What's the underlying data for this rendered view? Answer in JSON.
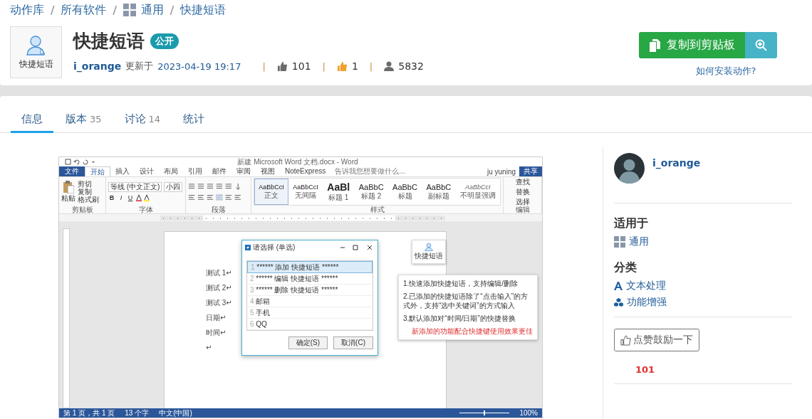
{
  "breadcrumb": [
    {
      "label": "动作库",
      "kind": "link"
    },
    {
      "separator": "/",
      "label": "所有软件",
      "kind": "link"
    },
    {
      "separator": "/",
      "label": "通用",
      "kind": "grid"
    },
    {
      "separator": "/",
      "label": "快捷短语",
      "kind": "link"
    }
  ],
  "action": {
    "icon_label": "快捷短语",
    "title": "快捷短语",
    "badge": "公开",
    "author": "i_orange",
    "updated_label": "更新于",
    "updated": "2023-04-19 19:17",
    "stats": [
      {
        "separator": "|",
        "kind": "like",
        "value": "101"
      },
      {
        "separator": "|",
        "kind": "reward",
        "value": "1"
      },
      {
        "separator": "|",
        "kind": "users",
        "value": "5832"
      }
    ]
  },
  "copy_button": "复制到剪贴板",
  "install_link": "如何安装动作?",
  "tabs": [
    {
      "label": "信息",
      "selected": true
    },
    {
      "label": "版本",
      "count": "35",
      "selected": false
    },
    {
      "label": "讨论",
      "count": "14",
      "selected": false
    },
    {
      "label": "统计",
      "selected": false
    }
  ],
  "word_window": {
    "title": "新建 Microsoft Word 文档.docx - Word",
    "tabs": [
      {
        "label": "文件",
        "kind": "file",
        "selected": false
      },
      {
        "label": "开始",
        "kind": "tab",
        "selected": true
      },
      {
        "label": "插入",
        "kind": "tab",
        "selected": false
      },
      {
        "label": "设计",
        "kind": "tab",
        "selected": false
      },
      {
        "label": "布局",
        "kind": "tab",
        "selected": false
      },
      {
        "label": "引用",
        "kind": "tab",
        "selected": false
      },
      {
        "label": "邮件",
        "kind": "tab",
        "selected": false
      },
      {
        "label": "审阅",
        "kind": "tab",
        "selected": false
      },
      {
        "label": "视图",
        "kind": "tab",
        "selected": false
      },
      {
        "label": "NoteExpress",
        "kind": "tab",
        "selected": false
      }
    ],
    "tell_me": "告诉我您想要做什么...",
    "user": "ju yuning",
    "share": "共享",
    "paste": "粘贴",
    "clipboard_items": [
      "剪切",
      "复制",
      "格式刷"
    ],
    "font_name": "等线 (中文正文)",
    "font_size": "小四",
    "font_buttons": [
      "B",
      "I",
      "U"
    ],
    "styles": [
      {
        "preview": "AaBbCcI",
        "name": "正文",
        "kind": "body",
        "selected": true
      },
      {
        "preview": "AaBbCcI",
        "name": "无间隔",
        "kind": "body",
        "selected": false
      },
      {
        "preview": "AaBl",
        "name": "标题 1",
        "kind": "heading",
        "selected": false
      },
      {
        "preview": "AaBbC",
        "name": "标题 2",
        "kind": "subheading",
        "selected": false
      },
      {
        "preview": "AaBbC",
        "name": "标题",
        "kind": "subheading",
        "selected": false
      },
      {
        "preview": "AaBbC",
        "name": "副标题",
        "kind": "subheading",
        "selected": false
      },
      {
        "preview": "AaBbCcI",
        "name": "不明显强调",
        "kind": "emphasis",
        "selected": false
      }
    ],
    "editing": [
      "查找",
      "替换",
      "选择"
    ],
    "groups": [
      "剪贴板",
      "字体",
      "段落",
      "样式",
      "编辑"
    ],
    "lines": [
      "测试 1↵",
      "测试 2↵",
      "测试 3↵",
      "日期↵",
      "时间↵",
      "↵"
    ],
    "dialog": {
      "title": "请选择 (单选)",
      "items": [
        {
          "index": "1",
          "text": "****** 添加 快捷短语 ******",
          "selected": true
        },
        {
          "index": "2",
          "text": "****** 编辑 快捷短语 ******",
          "selected": false
        },
        {
          "index": "3",
          "text": "****** 删除 快捷短语 ******",
          "selected": false
        },
        {
          "index": "4",
          "text": "邮箱",
          "selected": false
        },
        {
          "index": "5",
          "text": "手机",
          "selected": false
        },
        {
          "index": "6",
          "text": "QQ",
          "selected": false
        }
      ],
      "buttons": [
        "确定(S)",
        "取消(C)"
      ]
    },
    "float_icon_label": "快捷短语",
    "tip_lines": [
      "1.快速添加快捷短语，支持编辑/删除",
      "2.已添加的快捷短语除了“点击输入”的方式外，支持“选中关键词”的方式输入",
      "3.默认添加对“时间/日期”的快捷替换"
    ],
    "tip_note": "新添加的功能配合快捷键使用效果更佳",
    "status": [
      "第 1 页，共 1 页",
      "13 个字",
      "中文(中国)"
    ],
    "zoom": "100%"
  },
  "sidebar": {
    "author": "i_orange",
    "applies_heading": "适用于",
    "applies": [
      {
        "kind": "grid",
        "label": "通用"
      }
    ],
    "category_heading": "分类",
    "categories": [
      {
        "kind": "text",
        "label": "文本处理"
      },
      {
        "kind": "boost",
        "label": "功能增强"
      }
    ],
    "like_button": "点赞鼓励一下",
    "like_count": "101"
  }
}
